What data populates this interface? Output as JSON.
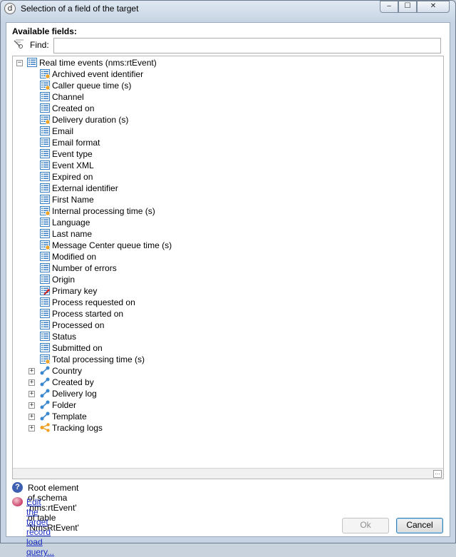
{
  "window": {
    "title": "Selection of a field of the target",
    "controls": {
      "minimize": "‒",
      "maximize": "☐",
      "close": "✕"
    }
  },
  "panel": {
    "available_label": "Available fields:",
    "find_label": "Find:",
    "find_value": ""
  },
  "tree": {
    "root": {
      "label": "Real time events (nms:rtEvent)",
      "icon": "list-icon",
      "expanded": true
    },
    "fields": [
      {
        "label": "Archived event identifier",
        "icon": "computed-field-icon"
      },
      {
        "label": "Caller queue time (s)",
        "icon": "computed-field-icon"
      },
      {
        "label": "Channel",
        "icon": "field-icon"
      },
      {
        "label": "Created on",
        "icon": "field-icon"
      },
      {
        "label": "Delivery duration (s)",
        "icon": "computed-field-icon"
      },
      {
        "label": "Email",
        "icon": "field-icon"
      },
      {
        "label": "Email format",
        "icon": "field-icon"
      },
      {
        "label": "Event type",
        "icon": "field-icon"
      },
      {
        "label": "Event XML",
        "icon": "field-icon"
      },
      {
        "label": "Expired on",
        "icon": "field-icon"
      },
      {
        "label": "External identifier",
        "icon": "field-icon"
      },
      {
        "label": "First Name",
        "icon": "field-icon"
      },
      {
        "label": "Internal processing time (s)",
        "icon": "computed-field-icon"
      },
      {
        "label": "Language",
        "icon": "field-icon"
      },
      {
        "label": "Last name",
        "icon": "field-icon"
      },
      {
        "label": "Message Center queue time (s)",
        "icon": "computed-field-icon"
      },
      {
        "label": "Modified on",
        "icon": "field-icon"
      },
      {
        "label": "Number of errors",
        "icon": "field-icon"
      },
      {
        "label": "Origin",
        "icon": "field-icon"
      },
      {
        "label": "Primary key",
        "icon": "primary-key-icon"
      },
      {
        "label": "Process requested on",
        "icon": "field-icon"
      },
      {
        "label": "Process started on",
        "icon": "field-icon"
      },
      {
        "label": "Processed on",
        "icon": "field-icon"
      },
      {
        "label": "Status",
        "icon": "field-icon"
      },
      {
        "label": "Submitted on",
        "icon": "field-icon"
      },
      {
        "label": "Total processing time (s)",
        "icon": "computed-field-icon"
      }
    ],
    "links": [
      {
        "label": "Country",
        "icon": "link-icon"
      },
      {
        "label": "Created by",
        "icon": "link-icon"
      },
      {
        "label": "Delivery log",
        "icon": "link-icon"
      },
      {
        "label": "Folder",
        "icon": "link-icon"
      },
      {
        "label": "Template",
        "icon": "link-icon"
      },
      {
        "label": "Tracking logs",
        "icon": "collection-link-icon"
      }
    ]
  },
  "status": {
    "description": "Root element of schema 'nms:rtEvent' of table 'NmsRtEvent'",
    "query_link": "Edit the target record load query..."
  },
  "buttons": {
    "ok": "Ok",
    "cancel": "Cancel"
  },
  "colors": {
    "list_icon": "#3a7fc4",
    "computed_badge": "#f0a020",
    "primary_key": "#d02020",
    "link_icon": "#3a88cf",
    "collection_link_icon": "#f0a020",
    "hyperlink": "#1a2fc4"
  }
}
